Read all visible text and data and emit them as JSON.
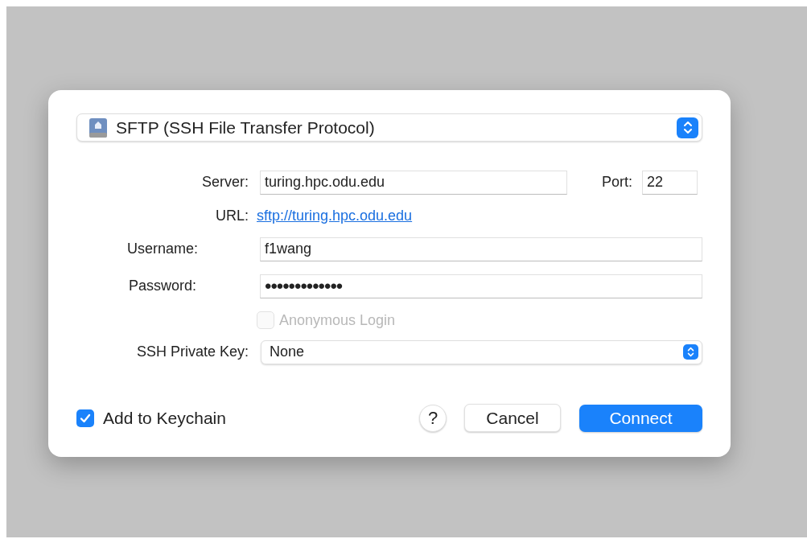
{
  "protocol_popup": {
    "value": "SFTP (SSH File Transfer Protocol)"
  },
  "server": {
    "label": "Server:",
    "value": "turing.hpc.odu.edu"
  },
  "port": {
    "label": "Port:",
    "value": "22"
  },
  "url": {
    "label": "URL:",
    "link": "sftp://turing.hpc.odu.edu"
  },
  "username": {
    "label": "Username:",
    "value": "f1wang"
  },
  "password": {
    "label": "Password:",
    "value": "•••••••••••••"
  },
  "anonymous_login": {
    "label": "Anonymous Login",
    "checked": false,
    "disabled": true
  },
  "ssh_private_key": {
    "label": "SSH Private Key:",
    "value": "None"
  },
  "add_to_keychain": {
    "label": "Add to Keychain",
    "checked": true,
    "disabled": false
  },
  "help_button": {
    "label": "?"
  },
  "buttons": [
    {
      "label": "Cancel",
      "kind": "secondary"
    },
    {
      "label": "Connect",
      "kind": "primary"
    }
  ]
}
